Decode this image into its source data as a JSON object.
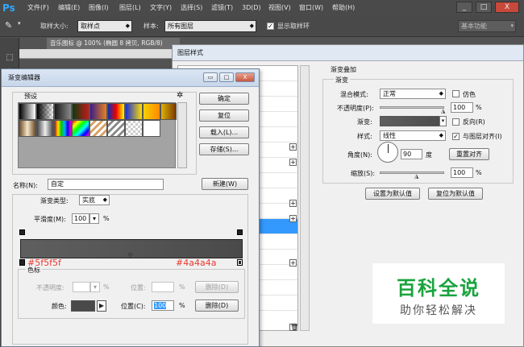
{
  "app": {
    "logo": "Ps",
    "menus": [
      "文件(F)",
      "编辑(E)",
      "图像(I)",
      "图层(L)",
      "文字(Y)",
      "选择(S)",
      "滤镜(T)",
      "3D(D)",
      "视图(V)",
      "窗口(W)",
      "帮助(H)"
    ],
    "window_buttons": [
      "_",
      "□",
      "X"
    ]
  },
  "options_bar": {
    "sample_size_label": "取样大小:",
    "sample_size_value": "取样点",
    "sample_label": "样本:",
    "sample_value": "所有图层",
    "show_ring_label": "显示取样环",
    "workspace_value": "基本功能"
  },
  "document": {
    "tab_title": "音乐图标 @ 100% (椭圆 8 拷贝, RGB/8)"
  },
  "layer_style": {
    "title": "图层样式",
    "section_title": "渐变叠加",
    "group_title": "渐变",
    "blend_mode_label": "混合模式:",
    "blend_mode_value": "正常",
    "dither_label": "仿色",
    "opacity_label": "不透明度(P):",
    "opacity_value": "100",
    "opacity_unit": "%",
    "gradient_label": "渐变:",
    "reverse_label": "反向(R)",
    "style_label": "样式:",
    "style_value": "线性",
    "align_label": "与图层对齐(I)",
    "angle_label": "角度(N):",
    "angle_value": "90",
    "angle_unit": "度",
    "reset_align_button": "重置对齐",
    "scale_label": "缩放(S):",
    "scale_value": "100",
    "scale_unit": "%",
    "set_default_button": "设置为默认值",
    "reset_default_button": "复位为默认值"
  },
  "gradient_editor": {
    "title": "渐变编辑器",
    "title_buttons": [
      "▭",
      "□",
      "X"
    ],
    "presets_label": "预设",
    "gear_icon": "gear-icon",
    "ok_button": "确定",
    "reset_button": "复位",
    "load_button": "载入(L)...",
    "save_button": "存储(S)...",
    "name_label": "名称(N):",
    "name_value": "自定",
    "new_button": "新建(W)",
    "gradient_type_label": "渐变类型:",
    "gradient_type_value": "实底",
    "smoothness_label": "平滑度(M):",
    "smoothness_value": "100",
    "smoothness_unit": "%",
    "gradient_start_color": "#5f5f5f",
    "gradient_end_color": "#4a4a4a",
    "left_note": "#5f5f5f",
    "right_note": "#4a4a4a",
    "stops_group_title": "色标",
    "stop_opacity_label": "不透明度:",
    "stop_opacity_unit": "%",
    "stop_opacity_position_label": "位置:",
    "stop_opacity_position_unit": "%",
    "delete_opacity_button": "删除(D)",
    "stop_color_label": "颜色:",
    "stop_color_value": "#4a4a4a",
    "stop_location_label": "位置(C):",
    "stop_location_value": "100",
    "stop_location_unit": "%",
    "delete_color_button": "删除(D)"
  },
  "watermark": {
    "title": "百科全说",
    "subtitle": "助你轻松解决"
  }
}
